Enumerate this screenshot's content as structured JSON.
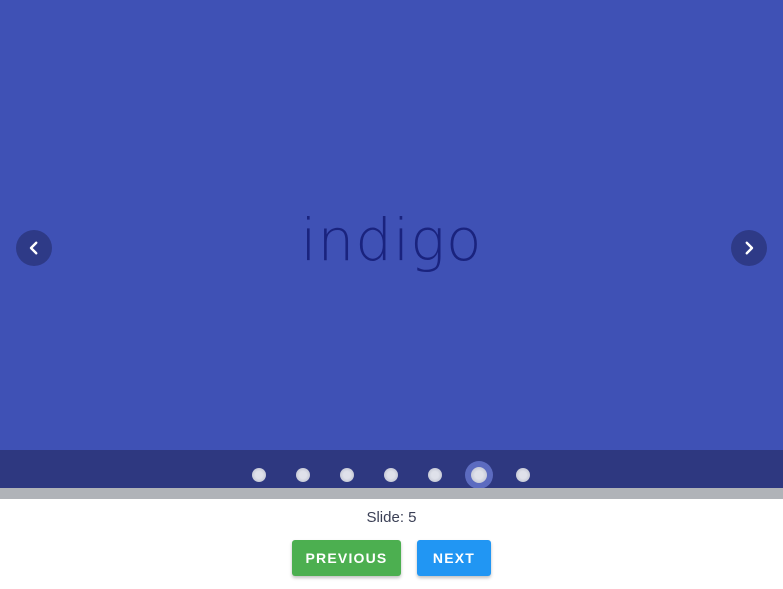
{
  "carousel": {
    "slide_text": "indigo",
    "background_color": "#3f51b5",
    "text_color": "#1a237e",
    "prev_arrow_icon": "chevron-left-icon",
    "next_arrow_icon": "chevron-right-icon",
    "total_slides": 7,
    "active_index": 5
  },
  "status": {
    "slide_label": "Slide: 5"
  },
  "controls": {
    "previous_label": "PREVIOUS",
    "next_label": "NEXT",
    "previous_color": "#4caf50",
    "next_color": "#2196f3"
  }
}
